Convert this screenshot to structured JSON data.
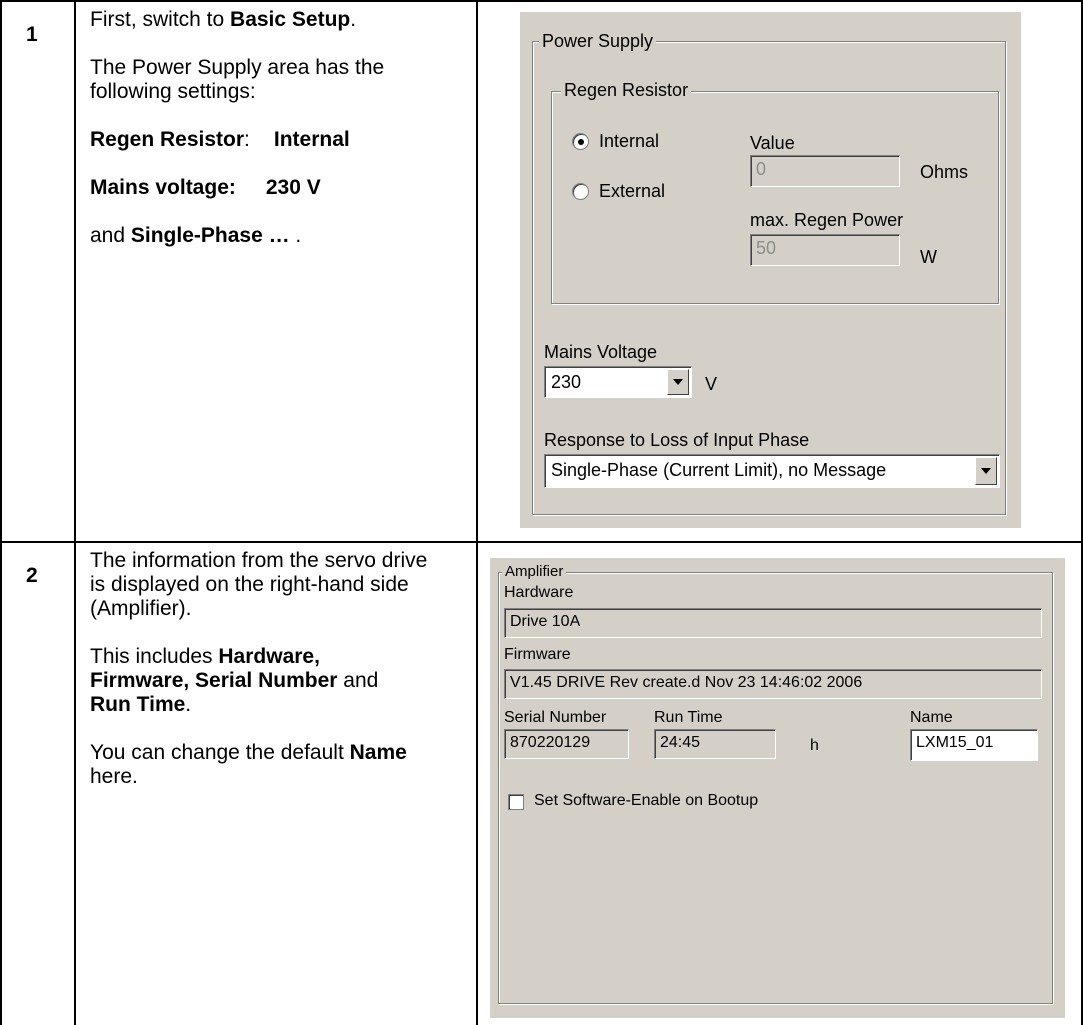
{
  "rows": [
    {
      "number": "1",
      "step": {
        "p1_pre": "First, switch to ",
        "p1_bold": "Basic Setup",
        "p1_post": ".",
        "p2": "The Power Supply area has the following settings:",
        "regen_label": "Regen Resistor",
        "regen_colon": ":",
        "regen_value": "Internal",
        "mains_label": "Mains voltage:",
        "mains_value": "230 V",
        "p5_pre": "and ",
        "p5_bold": "Single-Phase …",
        "p5_post": " ."
      }
    },
    {
      "number": "2",
      "step": {
        "p1": "The information from the servo drive is displayed on the right-hand side (Amplifier).",
        "p2_pre": "This includes ",
        "p2_bold1": "Hardware, Firmware, Serial Number",
        "p2_mid": " and ",
        "p2_bold2": "Run Time",
        "p2_post": ".",
        "p3_pre": "You can change the default ",
        "p3_bold": "Name",
        "p3_post": " here."
      }
    }
  ],
  "power_supply": {
    "title": "Power Supply",
    "regen_group": "Regen Resistor",
    "radio_internal": "Internal",
    "radio_external": "External",
    "selected": "Internal",
    "value_label": "Value",
    "value": "0",
    "value_unit": "Ohms",
    "max_power_label": "max. Regen Power",
    "max_power": "50",
    "max_power_unit": "W",
    "mains_label": "Mains Voltage",
    "mains_value": "230",
    "mains_unit": "V",
    "phase_label": "Response to Loss of Input Phase",
    "phase_value": "Single-Phase (Current Limit), no Message"
  },
  "amplifier": {
    "title": "Amplifier",
    "hardware_label": "Hardware",
    "hardware": "Drive 10A",
    "firmware_label": "Firmware",
    "firmware": "V1.45 DRIVE Rev create.d Nov 23 14:46:02 2006",
    "serial_label": "Serial Number",
    "serial": "870220129",
    "runtime_label": "Run Time",
    "runtime": "24:45",
    "runtime_unit": "h",
    "name_label": "Name",
    "name": "LXM15_01",
    "checkbox_label": "Set Software-Enable on Bootup",
    "checkbox_checked": false
  }
}
